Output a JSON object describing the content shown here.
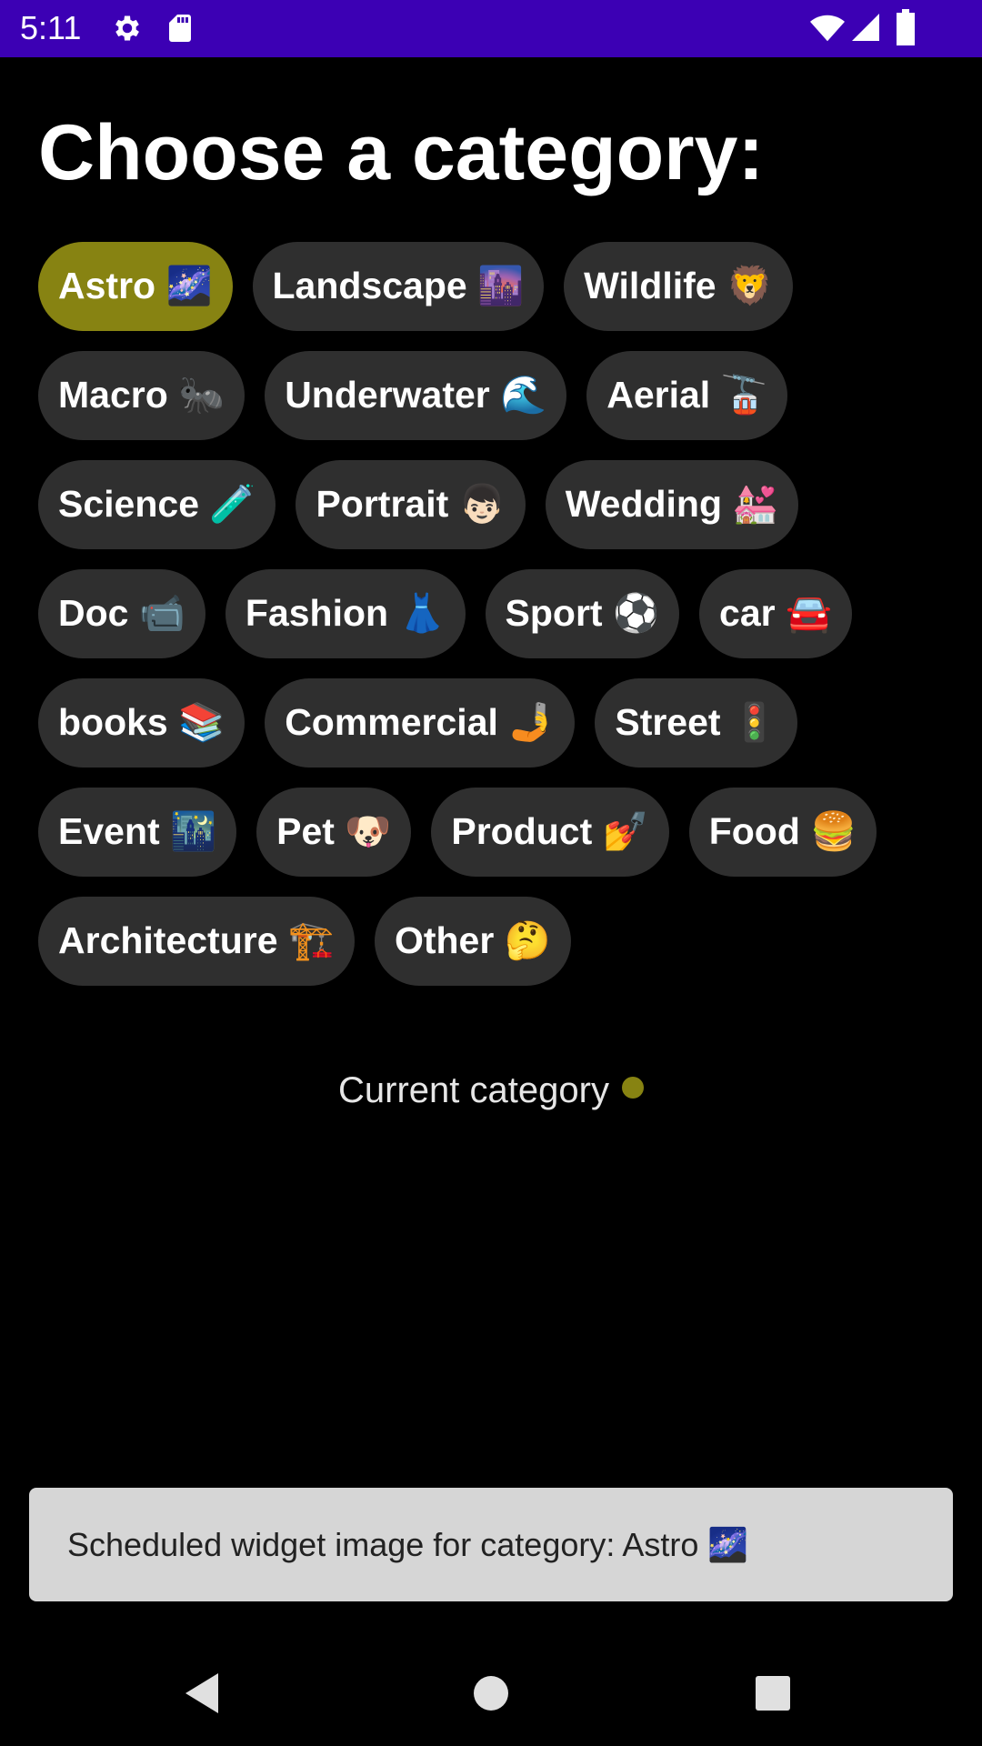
{
  "status_bar": {
    "time": "5:11",
    "background_color": "#3c00b4",
    "icons": [
      "gear-icon",
      "sd-card-icon",
      "wifi-icon",
      "signal-icon",
      "battery-icon"
    ]
  },
  "heading": "Choose a category:",
  "chips": [
    {
      "label": "Astro 🌌",
      "selected": true
    },
    {
      "label": "Landscape 🌆",
      "selected": false
    },
    {
      "label": "Wildlife 🦁",
      "selected": false
    },
    {
      "label": "Macro 🐜",
      "selected": false
    },
    {
      "label": "Underwater 🌊",
      "selected": false
    },
    {
      "label": "Aerial 🚡",
      "selected": false
    },
    {
      "label": "Science 🧪",
      "selected": false
    },
    {
      "label": "Portrait 👦🏻",
      "selected": false
    },
    {
      "label": "Wedding 💒",
      "selected": false
    },
    {
      "label": "Doc 📹",
      "selected": false
    },
    {
      "label": "Fashion 👗",
      "selected": false
    },
    {
      "label": "Sport ⚽",
      "selected": false
    },
    {
      "label": "car 🚘",
      "selected": false
    },
    {
      "label": "books 📚",
      "selected": false
    },
    {
      "label": "Commercial 🤳",
      "selected": false
    },
    {
      "label": "Street 🚦",
      "selected": false
    },
    {
      "label": "Event 🌃",
      "selected": false
    },
    {
      "label": "Pet 🐶",
      "selected": false
    },
    {
      "label": "Product 💅",
      "selected": false
    },
    {
      "label": "Food 🍔",
      "selected": false
    },
    {
      "label": "Architecture 🏗️",
      "selected": false
    },
    {
      "label": "Other 🤔",
      "selected": false
    }
  ],
  "current_category": {
    "label": "Current category",
    "dot_color": "#878312"
  },
  "snackbar": {
    "text": "Scheduled widget image for category: Astro 🌌"
  },
  "colors": {
    "background": "#000000",
    "chip": "#2f2f2f",
    "chip_selected": "#878312",
    "snackbar": "#d6d6d6"
  },
  "nav_bar": {
    "icons": [
      "back-icon",
      "home-icon",
      "recents-icon"
    ]
  }
}
